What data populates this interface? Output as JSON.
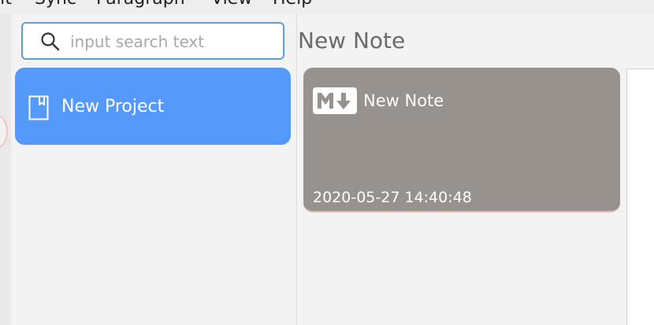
{
  "menubar": {
    "items": [
      "lit",
      "Sync",
      "Paragraph",
      "View",
      "Help"
    ]
  },
  "search": {
    "placeholder": "input search text",
    "value": ""
  },
  "sidebar": {
    "projects": [
      {
        "label": "New Project",
        "icon": "bookmark-icon",
        "selected": true
      }
    ]
  },
  "notes": {
    "title": "New Note",
    "items": [
      {
        "title": "New Note",
        "icon": "markdown-icon",
        "date": "2020-05-27 14:40:48"
      }
    ]
  },
  "colors": {
    "accent": "#5599fb",
    "search_border": "#5b9edc",
    "note_card": "#97928e"
  }
}
